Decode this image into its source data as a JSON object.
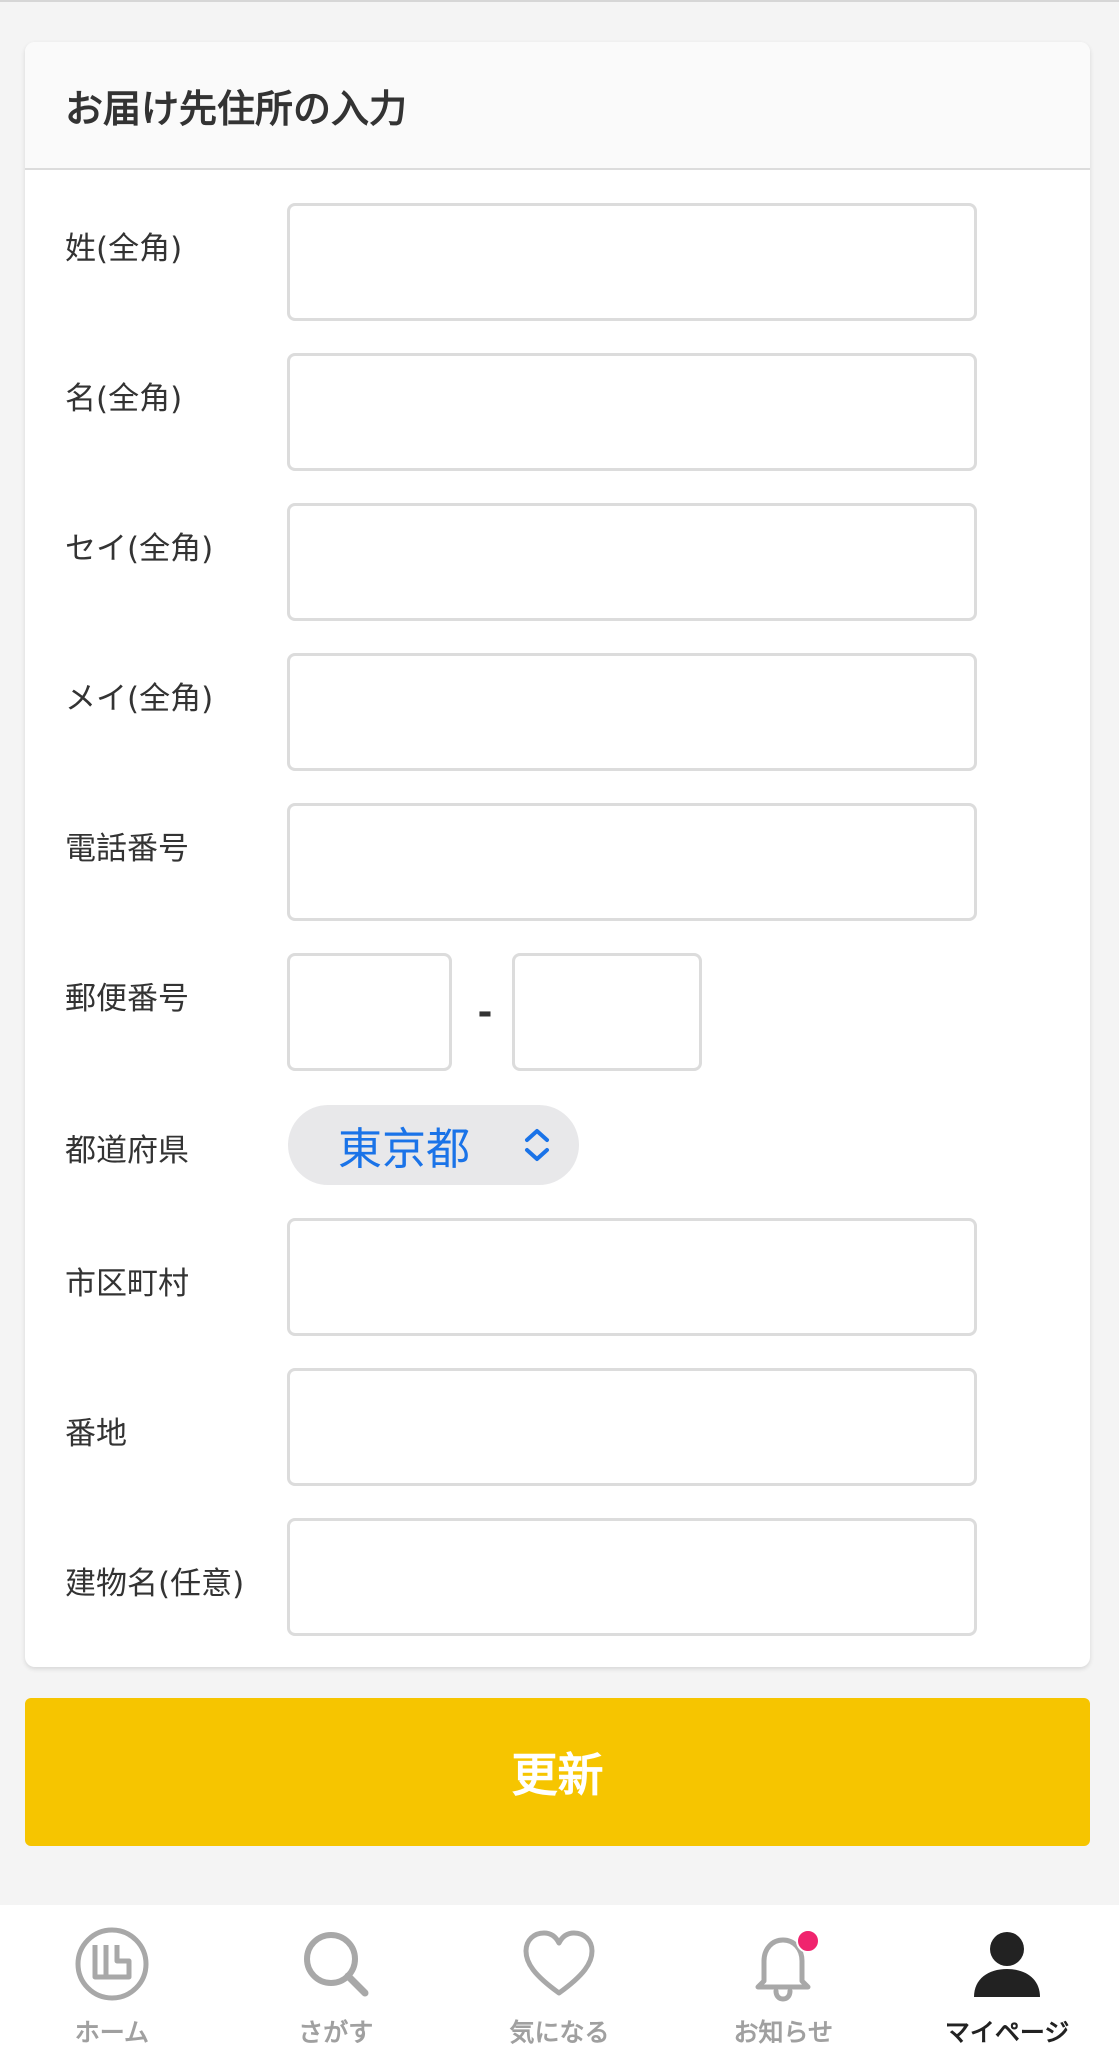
{
  "card": {
    "title": "お届け先住所の入力"
  },
  "fields": {
    "last_name": {
      "label": "姓(全角)",
      "value": ""
    },
    "first_name": {
      "label": "名(全角)",
      "value": ""
    },
    "last_kana": {
      "label": "セイ(全角)",
      "value": ""
    },
    "first_kana": {
      "label": "メイ(全角)",
      "value": ""
    },
    "phone": {
      "label": "電話番号",
      "value": ""
    },
    "postal": {
      "label": "郵便番号",
      "separator": "-",
      "value1": "",
      "value2": ""
    },
    "prefecture": {
      "label": "都道府県",
      "selected": "東京都"
    },
    "city": {
      "label": "市区町村",
      "value": ""
    },
    "street": {
      "label": "番地",
      "value": ""
    },
    "building": {
      "label": "建物名(任意)",
      "value": ""
    }
  },
  "submit": {
    "label": "更新"
  },
  "colors": {
    "accent": "#f6c500",
    "select_text": "#1a73e8",
    "badge": "#f0246e"
  },
  "tabbar": {
    "items": [
      {
        "label": "ホーム",
        "icon": "home-logo-icon",
        "active": false
      },
      {
        "label": "さがす",
        "icon": "search-icon",
        "active": false
      },
      {
        "label": "気になる",
        "icon": "heart-icon",
        "active": false
      },
      {
        "label": "お知らせ",
        "icon": "bell-icon",
        "active": false,
        "badge": true
      },
      {
        "label": "マイページ",
        "icon": "user-icon",
        "active": true
      }
    ]
  }
}
